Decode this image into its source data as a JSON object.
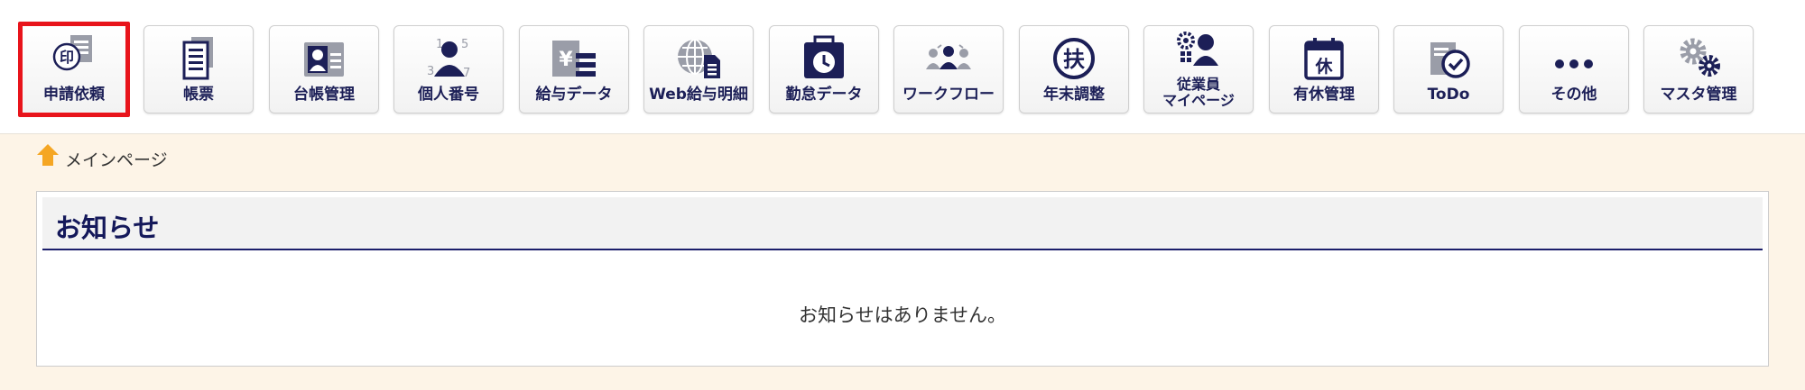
{
  "toolbar": {
    "items": [
      {
        "label": "申請依頼",
        "icon": "stamp-request-icon",
        "active": true
      },
      {
        "label": "帳票",
        "icon": "documents-icon"
      },
      {
        "label": "台帳管理",
        "icon": "id-card-icon"
      },
      {
        "label": "個人番号",
        "icon": "person-number-icon"
      },
      {
        "label": "給与データ",
        "icon": "yen-list-icon"
      },
      {
        "label": "Web給与明細",
        "icon": "globe-document-icon"
      },
      {
        "label": "勤怠データ",
        "icon": "clock-calendar-icon"
      },
      {
        "label": "ワークフロー",
        "icon": "people-flow-icon"
      },
      {
        "label": "年末調整",
        "icon": "circle-character-icon",
        "glyph": "扶"
      },
      {
        "label_line1": "従業員",
        "label_line2": "マイページ",
        "icon": "employee-gear-icon"
      },
      {
        "label": "有休管理",
        "icon": "calendar-icon",
        "glyph": "休"
      },
      {
        "label": "ToDo",
        "icon": "todo-check-icon"
      },
      {
        "label": "その他",
        "icon": "more-dots-icon"
      },
      {
        "label": "マスタ管理",
        "icon": "gears-icon"
      }
    ]
  },
  "breadcrumb": {
    "icon": "home-icon",
    "label": "メインページ"
  },
  "notice": {
    "title": "お知らせ",
    "message": "お知らせはありません。"
  },
  "colors": {
    "icon_navy": "#1c1f57",
    "icon_gray": "#9a9da8",
    "active_border": "#e8141b",
    "content_bg": "#fdf4e7",
    "title_navy": "#14185a",
    "home_orange": "#f5a623"
  }
}
